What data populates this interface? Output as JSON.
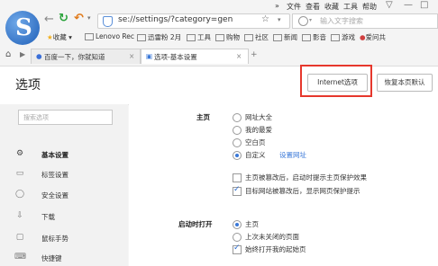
{
  "window": {
    "menu": [
      "文件",
      "查看",
      "收藏",
      "工具",
      "帮助"
    ],
    "controls": [
      "▽",
      "—",
      "□"
    ]
  },
  "toolbar": {
    "address": "se://settings/?category=gen",
    "star_icon": "☆",
    "search_placeholder": "输入文字搜索"
  },
  "bookmarks": [
    "收藏",
    "Lenovo Rec",
    "迅雷粉 2月",
    "工具",
    "购物",
    "社区",
    "新闻",
    "影音",
    "游戏",
    "爱问共"
  ],
  "tabs": [
    {
      "label": "百度一下，你就知道"
    },
    {
      "label": "选项-基本设置"
    }
  ],
  "page": {
    "title": "选项",
    "internet_options": "Internet选项",
    "restore_defaults": "恢复本页默认"
  },
  "sidebar": {
    "search_placeholder": "搜索选项",
    "items": [
      {
        "icon": "gear-icon",
        "label": "基本设置"
      },
      {
        "icon": "tab-icon",
        "label": "标签设置"
      },
      {
        "icon": "shield-icon",
        "label": "安全设置"
      },
      {
        "icon": "download-icon",
        "label": "下载"
      },
      {
        "icon": "mouse-icon",
        "label": "鼠标手势"
      },
      {
        "icon": "keyboard-icon",
        "label": "快捷键"
      }
    ]
  },
  "homepage": {
    "label": "主页",
    "options": [
      "网址大全",
      "我的最爱",
      "空白页",
      "自定义"
    ],
    "selected": "自定义",
    "set_url": "设置网址",
    "checks": [
      {
        "label": "主页被篡改后，启动时提示主页保护效果",
        "checked": false
      },
      {
        "label": "目标网站被篡改后，显示网页保护提示",
        "checked": true
      }
    ]
  },
  "startup": {
    "label": "启动时打开",
    "options": [
      "主页",
      "上次未关闭的页面"
    ],
    "selected": "主页",
    "check": {
      "label": "始终打开我的起始页",
      "checked": true
    }
  }
}
